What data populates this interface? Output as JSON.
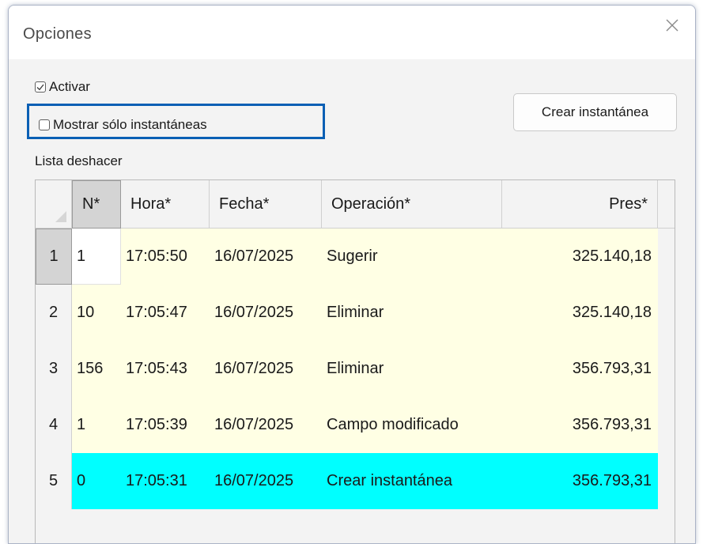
{
  "dialog": {
    "title": "Opciones"
  },
  "options": {
    "activar_label": "Activar",
    "activar_checked": true,
    "mostrar_label": "Mostrar sólo instantáneas",
    "mostrar_checked": false,
    "crear_button_label": "Crear instantánea"
  },
  "undo_list": {
    "label": "Lista deshacer",
    "columns": {
      "n": "N*",
      "hora": "Hora*",
      "fecha": "Fecha*",
      "operacion": "Operación*",
      "pres": "Pres*"
    },
    "rows": [
      {
        "index": "1",
        "n": "1",
        "hora": "17:05:50",
        "fecha": "16/07/2025",
        "operacion": "Sugerir",
        "pres": "325.140,18"
      },
      {
        "index": "2",
        "n": "10",
        "hora": "17:05:47",
        "fecha": "16/07/2025",
        "operacion": "Eliminar",
        "pres": "325.140,18"
      },
      {
        "index": "3",
        "n": "156",
        "hora": "17:05:43",
        "fecha": "16/07/2025",
        "operacion": "Eliminar",
        "pres": "356.793,31"
      },
      {
        "index": "4",
        "n": "1",
        "hora": "17:05:39",
        "fecha": "16/07/2025",
        "operacion": "Campo modificado",
        "pres": "356.793,31"
      },
      {
        "index": "5",
        "n": "0",
        "hora": "17:05:31",
        "fecha": "16/07/2025",
        "operacion": "Crear instantánea",
        "pres": "356.793,31"
      }
    ]
  },
  "colors": {
    "row_background": "#ffffe4",
    "snapshot_row_background": "#00ffff",
    "highlight_border": "#0a5fb4"
  }
}
